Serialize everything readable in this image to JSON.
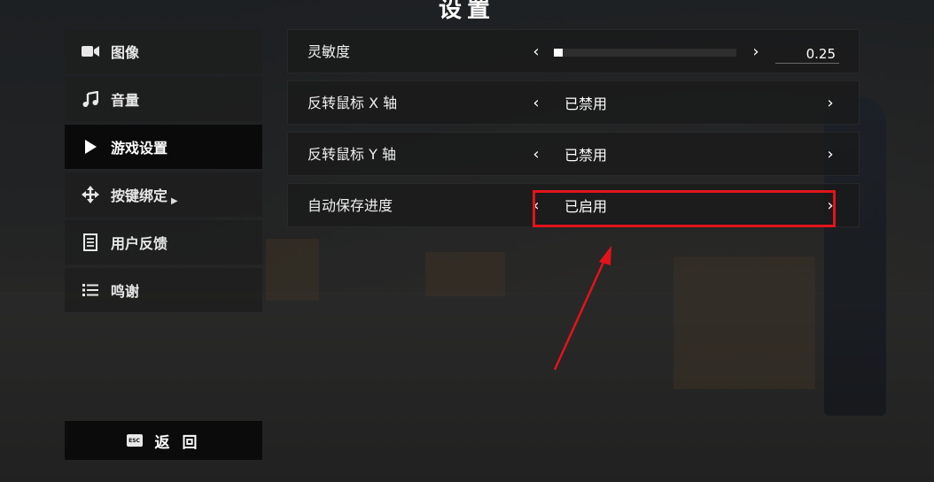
{
  "page": {
    "title": "设置"
  },
  "sidebar": {
    "items": [
      {
        "label": "图像",
        "icon": "video-camera-icon",
        "active": false
      },
      {
        "label": "音量",
        "icon": "music-note-icon",
        "active": false
      },
      {
        "label": "游戏设置",
        "icon": "play-icon",
        "active": true
      },
      {
        "label": "按键绑定",
        "icon": "move-arrows-icon",
        "active": false
      },
      {
        "label": "用户反馈",
        "icon": "feedback-document-icon",
        "active": false
      },
      {
        "label": "鸣谢",
        "icon": "list-icon",
        "active": false
      }
    ],
    "back": {
      "key": "ESC",
      "label": "返 回"
    }
  },
  "settings": {
    "rows": [
      {
        "label": "灵敏度",
        "type": "slider",
        "value": "0.25",
        "fill_fraction": 0.05
      },
      {
        "label": "反转鼠标 X 轴",
        "type": "selector",
        "value": "已禁用"
      },
      {
        "label": "反转鼠标 Y 轴",
        "type": "selector",
        "value": "已禁用"
      },
      {
        "label": "自动保存进度",
        "type": "selector",
        "value": "已启用"
      }
    ],
    "arrow_left": "‹",
    "arrow_right": "›"
  },
  "annotation": {
    "color": "#e3131b"
  }
}
